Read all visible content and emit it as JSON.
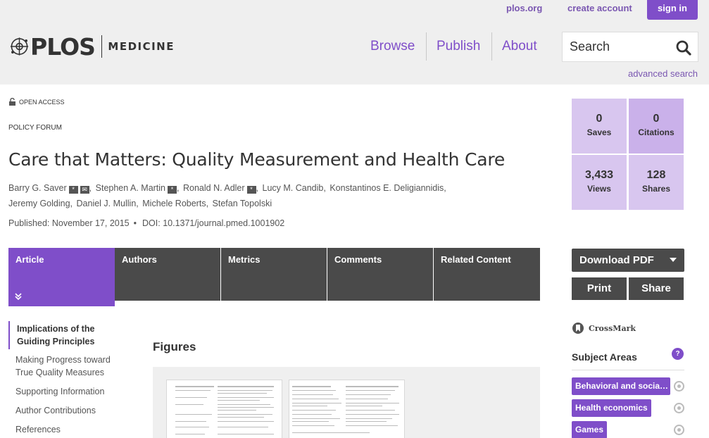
{
  "header": {
    "top_links": {
      "plos": "plos.org",
      "create_account": "create account",
      "sign_in": "sign in"
    },
    "logo": {
      "brand": "PLOS",
      "journal": "MEDICINE"
    },
    "nav": [
      "Browse",
      "Publish",
      "About"
    ],
    "search": {
      "placeholder": "Search",
      "icon": "search-icon"
    },
    "advanced_search": "advanced search"
  },
  "article": {
    "access": "OPEN ACCESS",
    "type": "POLICY FORUM",
    "title": "Care that Matters: Quality Measurement and Health Care",
    "authors": [
      {
        "name": "Barry G. Saver",
        "icons": [
          "*",
          "✉"
        ]
      },
      {
        "name": "Stephen A. Martin",
        "icons": [
          "*"
        ]
      },
      {
        "name": "Ronald N. Adler",
        "icons": [
          "*"
        ]
      },
      {
        "name": "Lucy M. Candib",
        "icons": []
      },
      {
        "name": "Konstantinos E. Deligiannidis",
        "icons": []
      },
      {
        "name": "Jeremy Golding",
        "icons": []
      },
      {
        "name": "Daniel J. Mullin",
        "icons": []
      },
      {
        "name": "Michele Roberts",
        "icons": []
      },
      {
        "name": "Stefan Topolski",
        "icons": []
      }
    ],
    "published": "Published: November 17, 2015",
    "doi": "DOI: 10.1371/journal.pmed.1001902"
  },
  "tabs": [
    "Article",
    "Authors",
    "Metrics",
    "Comments",
    "Related Content"
  ],
  "toc": {
    "active": "Implications of the Guiding Principles",
    "items": [
      "Making Progress toward True Quality Measures",
      "Supporting Information",
      "Author Contributions",
      "References"
    ]
  },
  "figures": {
    "heading": "Figures"
  },
  "metrics": [
    {
      "value": "0",
      "label": "Saves"
    },
    {
      "value": "0",
      "label": "Citations"
    },
    {
      "value": "3,433",
      "label": "Views"
    },
    {
      "value": "128",
      "label": "Shares"
    }
  ],
  "actions": {
    "download": "Download PDF",
    "print": "Print",
    "share": "Share"
  },
  "crossmark": "CrossMark",
  "subject_areas": {
    "title": "Subject Areas",
    "help": "?",
    "tags": [
      "Behavioral and social sciences",
      "Health economics",
      "Games"
    ]
  },
  "colors": {
    "accent": "#7f4ec9",
    "dark": "#4a4a4a",
    "metric": "#d8c6ef"
  }
}
